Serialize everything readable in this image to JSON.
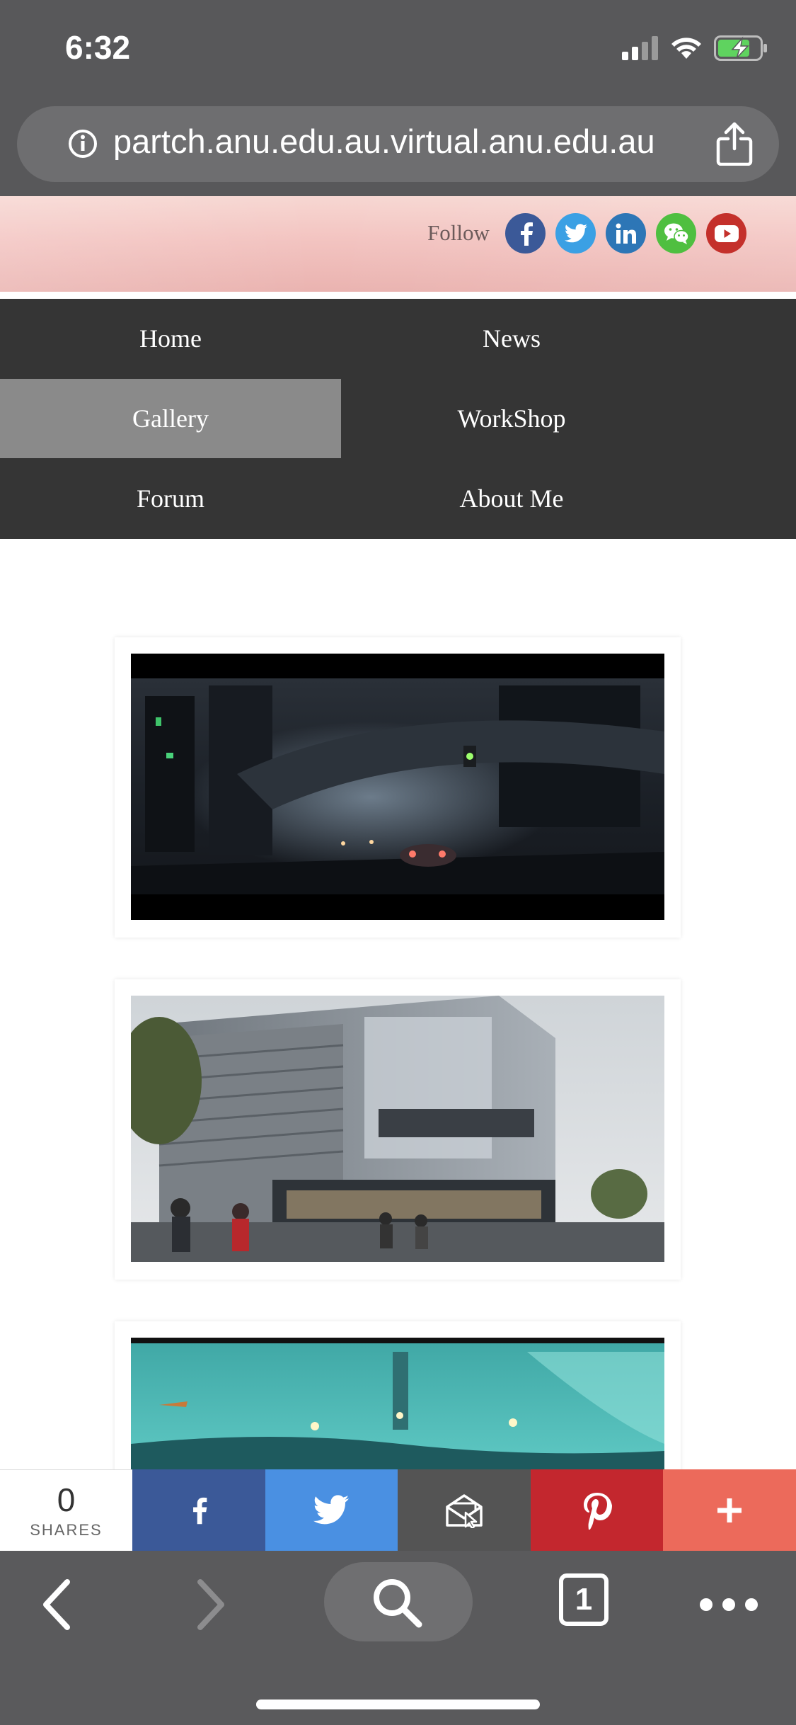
{
  "status_bar": {
    "time": "6:32"
  },
  "browser": {
    "url": "partch.anu.edu.au.virtual.anu.edu.au",
    "tab_count": "1"
  },
  "header": {
    "follow_label": "Follow",
    "social": [
      "facebook",
      "twitter",
      "linkedin",
      "wechat",
      "youtube"
    ]
  },
  "nav": {
    "items": [
      {
        "label": "Home"
      },
      {
        "label": "News"
      },
      {
        "label": "Gallery",
        "active": true
      },
      {
        "label": "WorkShop"
      },
      {
        "label": "Forum"
      },
      {
        "label": "About Me"
      }
    ]
  },
  "gallery": {
    "images": [
      "night-city-street-image",
      "futuristic-building-image",
      "teal-underwater-city-image"
    ]
  },
  "share_bar": {
    "count": "0",
    "count_label": "SHARES",
    "buttons": [
      "facebook",
      "twitter",
      "email",
      "pinterest",
      "more"
    ],
    "colors": {
      "facebook": "#3b5998",
      "twitter": "#4a90e2",
      "email": "#545454",
      "pinterest": "#c3272e",
      "more": "#ec6a5b"
    }
  }
}
